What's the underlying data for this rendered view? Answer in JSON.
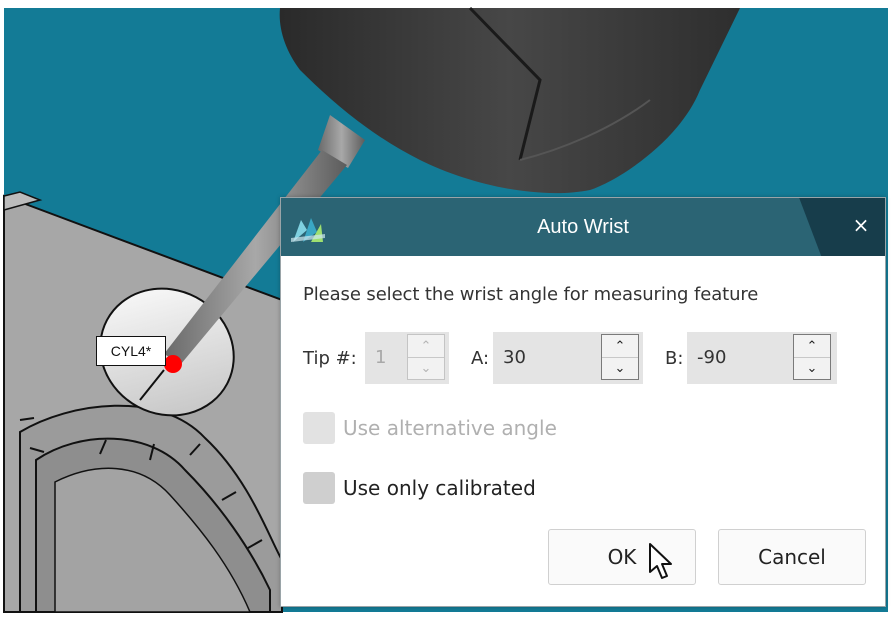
{
  "scene": {
    "feature_label": "CYL4*"
  },
  "dialog": {
    "title": "Auto Wrist",
    "close_glyph": "×",
    "prompt": "Please select the wrist angle for measuring feature",
    "tip": {
      "label": "Tip #:",
      "value": "1",
      "enabled": false
    },
    "angle_a": {
      "label": "A:",
      "value": "30"
    },
    "angle_b": {
      "label": "B:",
      "value": "-90"
    },
    "spin_up": "⌃",
    "spin_down": "⌄",
    "use_alternative_angle": {
      "label": "Use alternative angle",
      "checked": false,
      "enabled": false
    },
    "use_only_calibrated": {
      "label": "Use only calibrated",
      "checked": false,
      "enabled": true
    },
    "ok_label": "OK",
    "cancel_label": "Cancel"
  },
  "colors": {
    "background_teal": "#137b96",
    "titlebar": "#2b6474",
    "titlebar_dark": "#173d4b",
    "probe_tip": "#ff0000"
  },
  "icons": [
    "app-logo-icon",
    "close-icon",
    "spin-up-icon",
    "spin-down-icon",
    "mouse-cursor-icon"
  ]
}
